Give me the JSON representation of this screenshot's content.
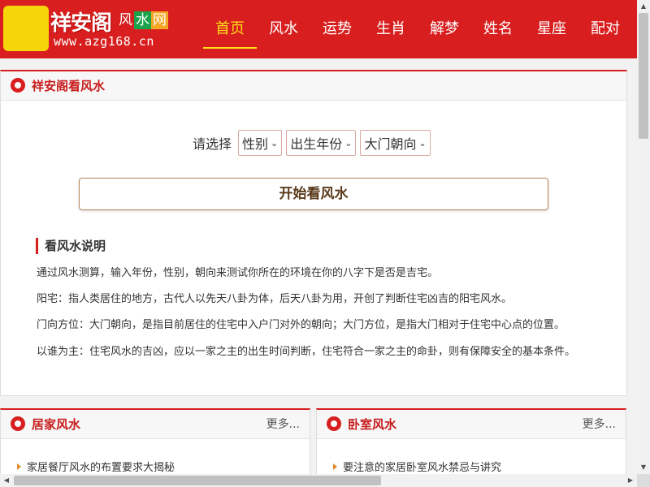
{
  "header": {
    "logo_brand": "祥安阁",
    "logo_chars": [
      "风",
      "水",
      "网"
    ],
    "logo_url": "www.azg168.cn",
    "nav": [
      {
        "label": "首页",
        "active": true
      },
      {
        "label": "风水",
        "active": false
      },
      {
        "label": "运势",
        "active": false
      },
      {
        "label": "生肖",
        "active": false
      },
      {
        "label": "解梦",
        "active": false
      },
      {
        "label": "姓名",
        "active": false
      },
      {
        "label": "星座",
        "active": false
      },
      {
        "label": "配对",
        "active": false
      }
    ]
  },
  "main": {
    "title": "祥安阁看风水",
    "form_label": "请选择",
    "selects": [
      "性别",
      "出生年份",
      "大门朝向"
    ],
    "start_button": "开始看风水",
    "desc_title": "看风水说明",
    "paragraphs": [
      "通过风水测算，输入年份，性别，朝向来测试你所在的环境在你的八字下是否是吉宅。",
      "阳宅：指人类居住的地方，古代人以先天八卦为体，后天八卦为用，开创了判断住宅凶吉的阳宅风水。",
      "门向方位：大门朝向，是指目前居住的住宅中入户门对外的朝向；大门方位，是指大门相对于住宅中心点的位置。",
      "以谁为主：住宅风水的吉凶，应以一家之主的出生时间判断，住宅符合一家之主的命卦，则有保障安全的基本条件。"
    ]
  },
  "left_panel": {
    "title": "居家风水",
    "more": "更多...",
    "items": [
      "家居餐厅风水的布置要求大揭秘"
    ]
  },
  "right_panel": {
    "title": "卧室风水",
    "more": "更多...",
    "items": [
      "要注意的家居卧室风水禁忌与讲究"
    ]
  },
  "colors": {
    "brand_red": "#d81e1e",
    "nav_active": "#ffe01a",
    "logo_yellow": "#f6d60a",
    "logo_green": "#1aa34a",
    "logo_orange": "#f5a623"
  }
}
